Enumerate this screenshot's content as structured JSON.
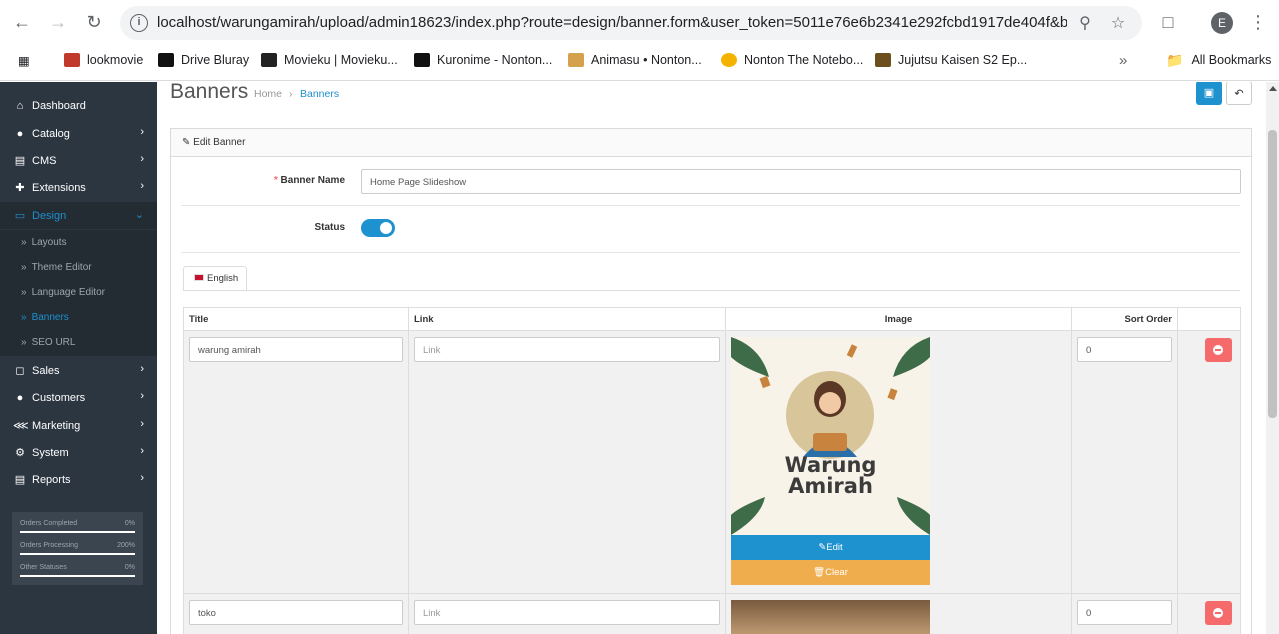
{
  "browser": {
    "url": "localhost/warungamirah/upload/admin18623/index.php?route=design/banner.form&user_token=5011e76e6b2341e292fcbd1917de404f&banner...",
    "profile_initial": "E",
    "bookmarks": [
      {
        "label": "lookmovie",
        "color": "#c0392b"
      },
      {
        "label": "Drive Bluray",
        "color": "#111111"
      },
      {
        "label": "Movieku | Movieku...",
        "color": "#222222"
      },
      {
        "label": "Kuronime - Nonton...",
        "color": "#111111"
      },
      {
        "label": "Animasu • Nonton...",
        "color": "#d4a24c"
      },
      {
        "label": "Nonton The Notebo...",
        "color": "#f5b301"
      },
      {
        "label": "Jujutsu Kaisen S2 Ep...",
        "color": "#6b4f1d"
      }
    ],
    "all_bookmarks": "All Bookmarks"
  },
  "sidebar": {
    "items": [
      {
        "label": "Dashboard",
        "icon": "home-icon"
      },
      {
        "label": "Catalog",
        "icon": "tag-icon"
      },
      {
        "label": "CMS",
        "icon": "newspaper-icon"
      },
      {
        "label": "Extensions",
        "icon": "puzzle-icon"
      },
      {
        "label": "Design",
        "icon": "monitor-icon"
      },
      {
        "label": "Sales",
        "icon": "cart-icon"
      },
      {
        "label": "Customers",
        "icon": "user-icon"
      },
      {
        "label": "Marketing",
        "icon": "share-icon"
      },
      {
        "label": "System",
        "icon": "gear-icon"
      },
      {
        "label": "Reports",
        "icon": "chart-icon"
      }
    ],
    "design_sub": [
      "Layouts",
      "Theme Editor",
      "Language Editor",
      "Banners",
      "SEO URL"
    ],
    "stats": [
      {
        "label": "Orders Completed",
        "value": "0%"
      },
      {
        "label": "Orders Processing",
        "value": "200%"
      },
      {
        "label": "Other Statuses",
        "value": "0%"
      }
    ]
  },
  "header": {
    "title": "Banners",
    "breadcrumb": [
      "Home",
      "Banners"
    ]
  },
  "form": {
    "panel_title": "Edit Banner",
    "banner_name_label": "Banner Name",
    "banner_name_value": "Home Page Slideshow",
    "status_label": "Status",
    "status_on": true,
    "language_tab": "English"
  },
  "table": {
    "headers": {
      "title": "Title",
      "link": "Link",
      "image": "Image",
      "sort": "Sort Order"
    },
    "link_placeholder": "Link",
    "edit_label": "Edit",
    "clear_label": "Clear",
    "rows": [
      {
        "title": "warung amirah",
        "sort": "0",
        "logo_line1": "Warung",
        "logo_line2": "Amirah"
      },
      {
        "title": "toko",
        "sort": "0"
      }
    ]
  }
}
